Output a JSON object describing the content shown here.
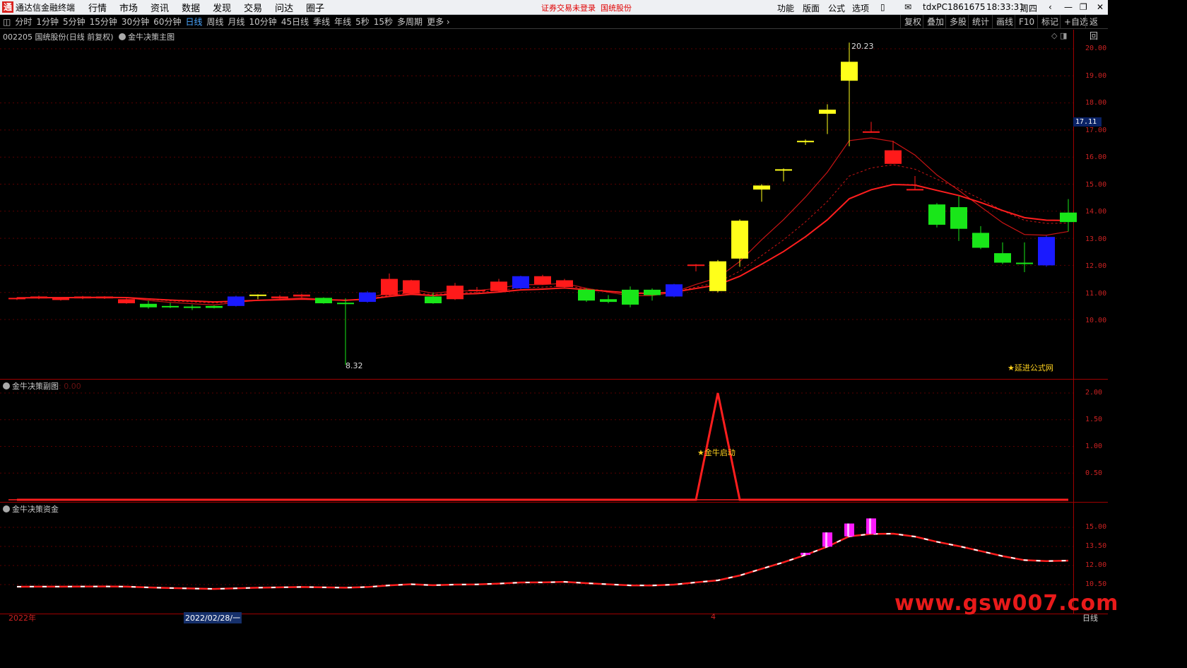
{
  "titlebar": {
    "app_name": "通达信金融终端",
    "menu": [
      "行情",
      "市场",
      "资讯",
      "数据",
      "发现",
      "交易",
      "问达",
      "圈子"
    ],
    "warning": "证券交易未登录",
    "stock_short": "国统股份",
    "right_items": [
      "功能",
      "版面",
      "公式",
      "选项"
    ],
    "user": "tdxPC1861675",
    "time": "18:33:31",
    "weekday": "周四"
  },
  "periods": [
    "分时",
    "1分钟",
    "5分钟",
    "15分钟",
    "30分钟",
    "60分钟",
    "日线",
    "周线",
    "月线",
    "10分钟",
    "45日线",
    "季线",
    "年线",
    "5秒",
    "15秒",
    "多周期",
    "更多"
  ],
  "active_period": "日线",
  "toolbar_right": [
    "复权",
    "叠加",
    "多股",
    "统计",
    "画线",
    "F10",
    "标记",
    "+自选",
    "返回"
  ],
  "main_panel": {
    "title": "002205 国统股份(日线 前复权)",
    "indicator": "金牛决策主图",
    "high_label": "20.23",
    "low_label": "8.32",
    "current_price": "17.11",
    "yticks": [
      "20.00",
      "19.00",
      "18.00",
      "17.00",
      "16.00",
      "15.00",
      "14.00",
      "13.00",
      "12.00",
      "11.00",
      "10.00"
    ],
    "note": "★延进公式网"
  },
  "sub_panel": {
    "title": "金牛决策副图",
    "value": ": 0.00",
    "yticks": [
      "2.00",
      "1.50",
      "1.00",
      "0.50"
    ],
    "signal": "★金牛启动"
  },
  "fund_panel": {
    "title": "金牛决策资金",
    "yticks": [
      "15.00",
      "13.50",
      "12.00",
      "10.50"
    ]
  },
  "xaxis": {
    "start": "2022年",
    "cursor_date": "2022/02/28/一",
    "mark": "4",
    "period": "日线"
  },
  "watermark": "www.gsw007.com",
  "colors": {
    "up": "#ff1a1a",
    "down": "#19e619",
    "strong": "#ffff1a",
    "blue": "#1a1aff",
    "volume": "#ff19ff"
  },
  "chart_data": [
    {
      "type": "candlestick",
      "title": "002205 国统股份(日线 前复权)",
      "ylim": [
        9.2,
        20.5
      ],
      "candles": [
        {
          "o": 10.75,
          "c": 10.8,
          "h": 10.82,
          "l": 10.72,
          "k": "up"
        },
        {
          "o": 10.78,
          "c": 10.85,
          "h": 10.88,
          "l": 10.75,
          "k": "up"
        },
        {
          "o": 10.72,
          "c": 10.8,
          "h": 10.82,
          "l": 10.7,
          "k": "up"
        },
        {
          "o": 10.78,
          "c": 10.85,
          "h": 10.87,
          "l": 10.75,
          "k": "up"
        },
        {
          "o": 10.78,
          "c": 10.85,
          "h": 10.86,
          "l": 10.76,
          "k": "up"
        },
        {
          "o": 10.6,
          "c": 10.75,
          "h": 10.78,
          "l": 10.58,
          "k": "up"
        },
        {
          "o": 10.58,
          "c": 10.45,
          "h": 10.7,
          "l": 10.4,
          "k": "down"
        },
        {
          "o": 10.5,
          "c": 10.45,
          "h": 10.62,
          "l": 10.42,
          "k": "down"
        },
        {
          "o": 10.48,
          "c": 10.46,
          "h": 10.55,
          "l": 10.35,
          "k": "down"
        },
        {
          "o": 10.5,
          "c": 10.43,
          "h": 10.52,
          "l": 10.41,
          "k": "down"
        },
        {
          "o": 10.5,
          "c": 10.85,
          "h": 10.88,
          "l": 10.48,
          "k": "blue"
        },
        {
          "o": 10.89,
          "c": 10.92,
          "h": 10.93,
          "l": 10.75,
          "k": "strong"
        },
        {
          "o": 10.78,
          "c": 10.85,
          "h": 10.9,
          "l": 10.76,
          "k": "up"
        },
        {
          "o": 10.85,
          "c": 10.92,
          "h": 10.95,
          "l": 10.8,
          "k": "up"
        },
        {
          "o": 10.8,
          "c": 10.6,
          "h": 10.82,
          "l": 10.58,
          "k": "down"
        },
        {
          "o": 10.62,
          "c": 10.58,
          "h": 10.78,
          "l": 8.32,
          "k": "down"
        },
        {
          "o": 10.65,
          "c": 11.0,
          "h": 11.05,
          "l": 10.62,
          "k": "blue"
        },
        {
          "o": 10.9,
          "c": 11.5,
          "h": 11.7,
          "l": 10.88,
          "k": "up"
        },
        {
          "o": 10.95,
          "c": 11.45,
          "h": 11.47,
          "l": 10.92,
          "k": "up"
        },
        {
          "o": 10.85,
          "c": 10.6,
          "h": 11.0,
          "l": 10.58,
          "k": "down"
        },
        {
          "o": 10.75,
          "c": 11.25,
          "h": 11.35,
          "l": 10.72,
          "k": "up"
        },
        {
          "o": 11.05,
          "c": 11.1,
          "h": 11.2,
          "l": 10.95,
          "k": "up"
        },
        {
          "o": 11.05,
          "c": 11.4,
          "h": 11.5,
          "l": 11.0,
          "k": "up"
        },
        {
          "o": 11.15,
          "c": 11.6,
          "h": 11.62,
          "l": 11.12,
          "k": "blue"
        },
        {
          "o": 11.6,
          "c": 11.3,
          "h": 11.65,
          "l": 11.28,
          "k": "up"
        },
        {
          "o": 11.2,
          "c": 11.45,
          "h": 11.5,
          "l": 11.15,
          "k": "up"
        },
        {
          "o": 11.1,
          "c": 10.7,
          "h": 11.15,
          "l": 10.65,
          "k": "down"
        },
        {
          "o": 10.75,
          "c": 10.65,
          "h": 10.9,
          "l": 10.6,
          "k": "down"
        },
        {
          "o": 11.1,
          "c": 10.55,
          "h": 11.22,
          "l": 10.45,
          "k": "down"
        },
        {
          "o": 11.1,
          "c": 10.9,
          "h": 11.15,
          "l": 10.7,
          "k": "down"
        },
        {
          "o": 10.85,
          "c": 11.3,
          "h": 11.32,
          "l": 10.82,
          "k": "blue"
        },
        {
          "o": 11.98,
          "c": 12.03,
          "h": 12.05,
          "l": 11.78,
          "k": "up"
        },
        {
          "o": 11.05,
          "c": 12.15,
          "h": 12.2,
          "l": 11.0,
          "k": "strong"
        },
        {
          "o": 12.25,
          "c": 13.65,
          "h": 13.7,
          "l": 11.95,
          "k": "strong"
        },
        {
          "o": 14.8,
          "c": 14.95,
          "h": 15.0,
          "l": 14.35,
          "k": "strong"
        },
        {
          "o": 15.5,
          "c": 15.55,
          "h": 15.58,
          "l": 15.1,
          "k": "strong"
        },
        {
          "o": 16.55,
          "c": 16.6,
          "h": 16.65,
          "l": 16.45,
          "k": "strong"
        },
        {
          "o": 17.6,
          "c": 17.75,
          "h": 17.95,
          "l": 16.85,
          "k": "strong"
        },
        {
          "o": 18.82,
          "c": 19.52,
          "h": 20.23,
          "l": 16.4,
          "k": "strong"
        },
        {
          "o": 16.9,
          "c": 16.95,
          "h": 17.3,
          "l": 16.9,
          "k": "up"
        },
        {
          "o": 15.75,
          "c": 16.25,
          "h": 16.6,
          "l": 15.75,
          "k": "up"
        },
        {
          "o": 14.8,
          "c": 14.82,
          "h": 15.3,
          "l": 14.78,
          "k": "up"
        },
        {
          "o": 14.25,
          "c": 13.5,
          "h": 14.3,
          "l": 13.4,
          "k": "down"
        },
        {
          "o": 14.15,
          "c": 13.35,
          "h": 14.55,
          "l": 12.9,
          "k": "down"
        },
        {
          "o": 13.2,
          "c": 12.65,
          "h": 13.45,
          "l": 12.6,
          "k": "down"
        },
        {
          "o": 12.45,
          "c": 12.1,
          "h": 12.85,
          "l": 12.05,
          "k": "down"
        },
        {
          "o": 12.1,
          "c": 12.05,
          "h": 12.85,
          "l": 11.75,
          "k": "down"
        },
        {
          "o": 12.0,
          "c": 13.05,
          "h": 13.1,
          "l": 11.95,
          "k": "blue"
        },
        {
          "o": 13.95,
          "c": 13.6,
          "h": 14.45,
          "l": 13.25,
          "k": "down"
        }
      ]
    },
    {
      "type": "line",
      "title": "金牛决策副图",
      "ylim": [
        0,
        2.2
      ],
      "values": [
        0,
        0,
        0,
        0,
        0,
        0,
        0,
        0,
        0,
        0,
        0,
        0,
        0,
        0,
        0,
        0,
        0,
        0,
        0,
        0,
        0,
        0,
        0,
        0,
        0,
        0,
        0,
        0,
        0,
        0,
        0,
        0,
        2,
        0,
        0,
        0,
        0,
        0,
        0,
        0,
        0,
        0,
        0,
        0,
        0,
        0,
        0,
        0,
        0
      ]
    },
    {
      "type": "bar",
      "title": "金牛决策资金",
      "ylim": [
        8.8,
        16.5
      ],
      "values": [
        0,
        0,
        0,
        0,
        0,
        0,
        0,
        0,
        0,
        0,
        0,
        0,
        0,
        0,
        0,
        0,
        0,
        0,
        0,
        0,
        0,
        0,
        0,
        0,
        0,
        0,
        0,
        0,
        0,
        0,
        0,
        0,
        0,
        10.4,
        11.0,
        11.9,
        13.0,
        14.6,
        15.3,
        15.7,
        0,
        0,
        0,
        0,
        0,
        0,
        0,
        0,
        0
      ]
    }
  ]
}
